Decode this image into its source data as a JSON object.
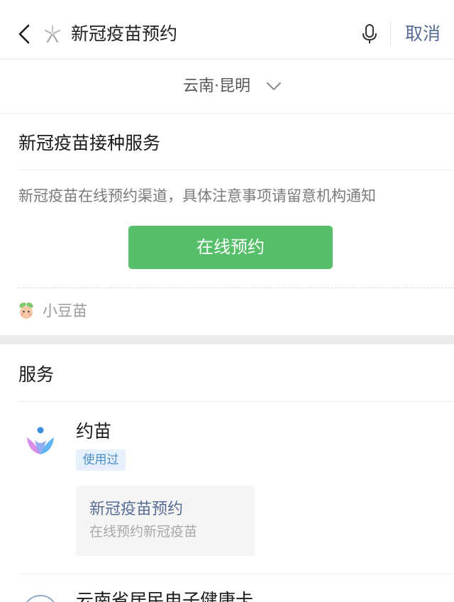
{
  "header": {
    "back_icon": "chevron-left-icon",
    "app_icon": "search-app-icon",
    "search_query": "新冠疫苗预约",
    "mic_icon": "microphone-icon",
    "cancel_label": "取消"
  },
  "region": {
    "label": "云南·昆明",
    "chevron_icon": "chevron-down-icon"
  },
  "card": {
    "title": "新冠疫苗接种服务",
    "description": "新冠疫苗在线预约渠道，具体注意事项请留意机构通知",
    "button_label": "在线预约",
    "source_name": "小豆苗",
    "source_icon": "xiaodoumiao-mascot-icon"
  },
  "services": {
    "title": "服务",
    "items": [
      {
        "name": "约苗",
        "badge": "使用过",
        "logo_icon": "yuemiao-logo-icon",
        "sub_card": {
          "title": "新冠疫苗预约",
          "desc": "在线预约新冠疫苗"
        }
      },
      {
        "name": "云南省居民电子健康卡",
        "logo_icon": "health-card-seal-icon"
      }
    ]
  },
  "colors": {
    "accent_link": "#576b95",
    "primary_button": "#57bf6a",
    "badge_bg": "#e6f1fb",
    "badge_text": "#4e8ec9"
  }
}
